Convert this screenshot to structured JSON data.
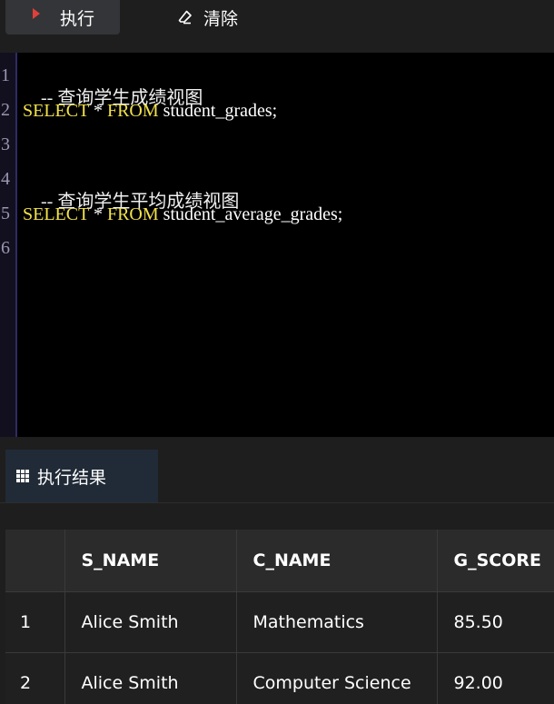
{
  "toolbar": {
    "run_label": "执行",
    "clear_label": "清除",
    "run_icon": "play-icon",
    "clear_icon": "eraser-icon"
  },
  "editor": {
    "line_numbers": [
      "1",
      "2",
      "3",
      "4",
      "5",
      "6"
    ],
    "lines": [
      {
        "comment": "-- 查询学生成绩视图"
      },
      {
        "kw1": "SELECT",
        "mid": " * ",
        "kw2": "FROM",
        "rest": " student_grades;"
      },
      {},
      {
        "comment": "-- 查询学生平均成绩视图"
      },
      {
        "kw1": "SELECT",
        "mid": " * ",
        "kw2": "FROM",
        "rest": " student_average_grades;"
      },
      {}
    ]
  },
  "results": {
    "tab_label": "执行结果",
    "tab_icon": "grid-icon",
    "columns": [
      "",
      "S_NAME",
      "C_NAME",
      "G_SCORE"
    ],
    "rows": [
      [
        "1",
        "Alice Smith",
        "Mathematics",
        "85.50"
      ],
      [
        "2",
        "Alice Smith",
        "Computer Science",
        "92.00"
      ]
    ]
  },
  "colors": {
    "keyword": "#f2e24a",
    "run_icon": "#e0403a",
    "background": "#1e1e1e",
    "editor_background": "#000000"
  }
}
